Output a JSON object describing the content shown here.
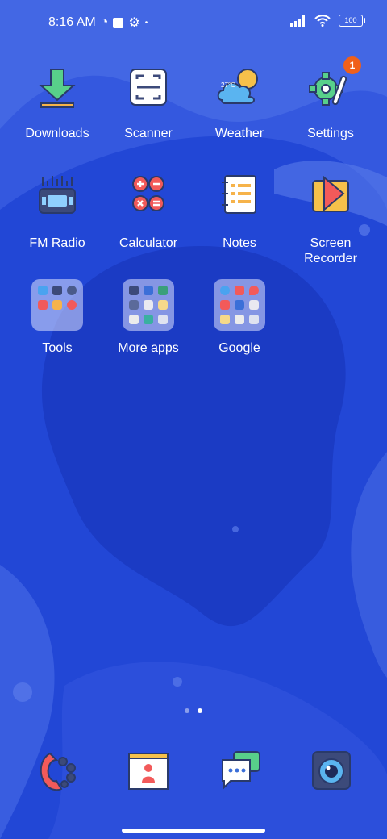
{
  "status": {
    "time": "8:16 AM",
    "battery": "100"
  },
  "apps": [
    {
      "name": "downloads",
      "label": "Downloads"
    },
    {
      "name": "scanner",
      "label": "Scanner"
    },
    {
      "name": "weather",
      "label": "Weather",
      "temp": "27°C"
    },
    {
      "name": "settings",
      "label": "Settings",
      "badge": "1"
    },
    {
      "name": "fm-radio",
      "label": "FM Radio"
    },
    {
      "name": "calculator",
      "label": "Calculator"
    },
    {
      "name": "notes",
      "label": "Notes"
    },
    {
      "name": "screen-recorder",
      "label": "Screen\nRecorder"
    },
    {
      "name": "tools",
      "label": "Tools"
    },
    {
      "name": "more-apps",
      "label": "More apps"
    },
    {
      "name": "google",
      "label": "Google"
    }
  ],
  "pages": {
    "count": 2,
    "current": 2
  },
  "dock": [
    {
      "name": "phone",
      "icon": "phone-icon"
    },
    {
      "name": "contacts",
      "icon": "contacts-icon"
    },
    {
      "name": "messages",
      "icon": "messages-icon"
    },
    {
      "name": "camera",
      "icon": "camera-icon"
    }
  ],
  "colors": {
    "wallpaper": "#2f55dd",
    "wallpaper_dark": "#1c3dc8",
    "badge": "#f0601a"
  }
}
